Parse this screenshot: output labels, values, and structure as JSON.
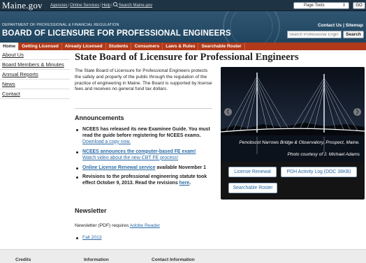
{
  "background": {
    "s_letter": "S",
    "link1": "ato",
    "link2": "ro",
    "n_text": "n u"
  },
  "govbar": {
    "logo": "Maine.gov",
    "agencies": "Agencies",
    "online_services": "Online Services",
    "help": "Help",
    "search": "Search Maine.gov",
    "page_tools": "Page Tools",
    "go": "GO"
  },
  "header": {
    "department": "Department of Professional & Financial Regulation",
    "board": "BOARD OF LICENSURE FOR PROFESSIONAL ENGINEERS",
    "contact_us": "Contact Us",
    "sitemap": "Sitemap",
    "search_placeholder": "Search Professional Engin",
    "search_button": "Search"
  },
  "tabs": [
    "Home",
    "Getting Licensed",
    "Already Licensed",
    "Students",
    "Consumers",
    "Laws & Rules",
    "Searchable Roster"
  ],
  "nav": [
    "About Us",
    "Board Members & Minutes",
    "Annual Reports",
    "News",
    "Contact"
  ],
  "main": {
    "title": "State Board of Licensure for Professional Engineers",
    "intro": "The State Board of Licensure for Professional Engineers protects the safety and property of the public through the regulation of the practice of engineering in Maine. The Board is supported by license fees and receives no general fund tax dollars.",
    "announcements_title": "Announcements",
    "ann1_text": "NCEES has released its new Examinee Guide. You must read the guide before registering for NCEES exams.",
    "ann1_link": "Download a copy now.",
    "ann2_link": "NCEES announces the computer-based FE exam!",
    "ann2_link2": "Watch video about the new CBT FE process!",
    "ann3_link": "Online License Renewal service",
    "ann3_text": "available November 1",
    "ann4_text": "Revisions to the professional engineering statute took effect October 9, 2013. Read the revisions",
    "ann4_link": "here",
    "ann4_end": ".",
    "newsletter_title": "Newsletter",
    "newsletter_text": "Newsletter (PDF) requires",
    "newsletter_link": "Adobe Reader",
    "newsletter_item": "Fall 2013"
  },
  "photo": {
    "caption": "Penobscot Narrows Bridge & Observatory, Prospect, Maine.",
    "credit": "Photo courtesy of J. Michael Adams",
    "btn_renewal": "License Renewal",
    "btn_pdh": "PDH Activity Log (DOC 38KB)",
    "btn_roster": "Searchable Roster"
  },
  "footer": {
    "credits": "Credits",
    "information": "Information",
    "contact": "Contact Information"
  }
}
